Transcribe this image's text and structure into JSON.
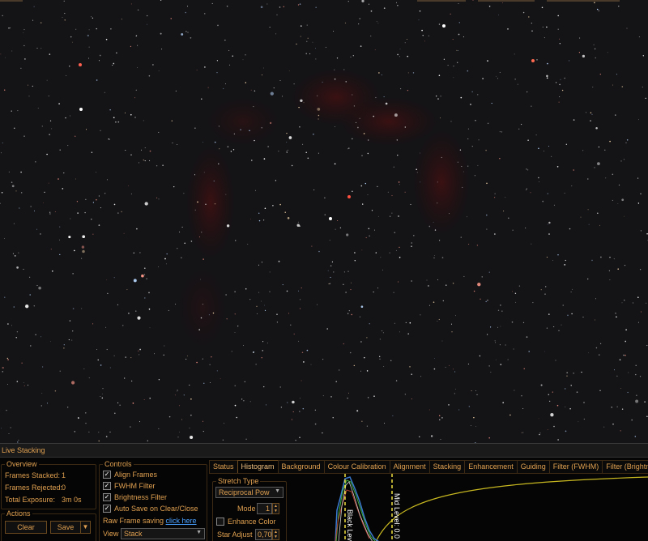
{
  "panel": {
    "title": "Live Stacking"
  },
  "overview": {
    "title": "Overview",
    "frames_stacked_label": "Frames Stacked:",
    "frames_stacked_value": "1",
    "frames_rejected_label": "Frames Rejected:",
    "frames_rejected_value": "0",
    "total_exposure_label": "Total Exposure:",
    "total_exposure_value": "3m 0s"
  },
  "actions": {
    "title": "Actions",
    "clear_label": "Clear",
    "save_label": "Save",
    "save_dropdown_icon": "chevron-down-icon"
  },
  "controls": {
    "title": "Controls",
    "align_frames_label": "Align Frames",
    "align_frames_checked": true,
    "fwhm_filter_label": "FWHM Filter",
    "fwhm_filter_checked": true,
    "brightness_filter_label": "Brightness Filter",
    "brightness_filter_checked": true,
    "auto_save_label": "Auto Save on Clear/Close",
    "auto_save_checked": true,
    "raw_frame_saving_label": "Raw Frame saving",
    "raw_frame_saving_link": "click here",
    "view_label": "View",
    "view_value": "Stack"
  },
  "tabs": [
    {
      "label": "Status",
      "active": false
    },
    {
      "label": "Histogram",
      "active": true
    },
    {
      "label": "Background",
      "active": false
    },
    {
      "label": "Colour Calibration",
      "active": false
    },
    {
      "label": "Alignment",
      "active": false
    },
    {
      "label": "Stacking",
      "active": false
    },
    {
      "label": "Enhancement",
      "active": false
    },
    {
      "label": "Guiding",
      "active": false
    },
    {
      "label": "Filter (FWHM)",
      "active": false
    },
    {
      "label": "Filter (Brightness",
      "active": false
    }
  ],
  "histogram": {
    "stretch_type_title": "Stretch Type",
    "stretch_type_value": "Reciprocal Pow",
    "mode_label": "Mode",
    "mode_value": "1",
    "enhance_color_label": "Enhance Color",
    "enhance_color_checked": false,
    "star_adjust_label": "Star Adjust",
    "star_adjust_value": "0,70",
    "black_level_label": "Black Lev",
    "mid_level_label": "Mid Level: 0.0"
  },
  "colors": {
    "accent": "#e0a050",
    "link": "#4aa0ff",
    "curve": "#c8b820",
    "level_marker": "#f0e040",
    "hist_blue": "#3a7ad0",
    "hist_green": "#40b040"
  }
}
